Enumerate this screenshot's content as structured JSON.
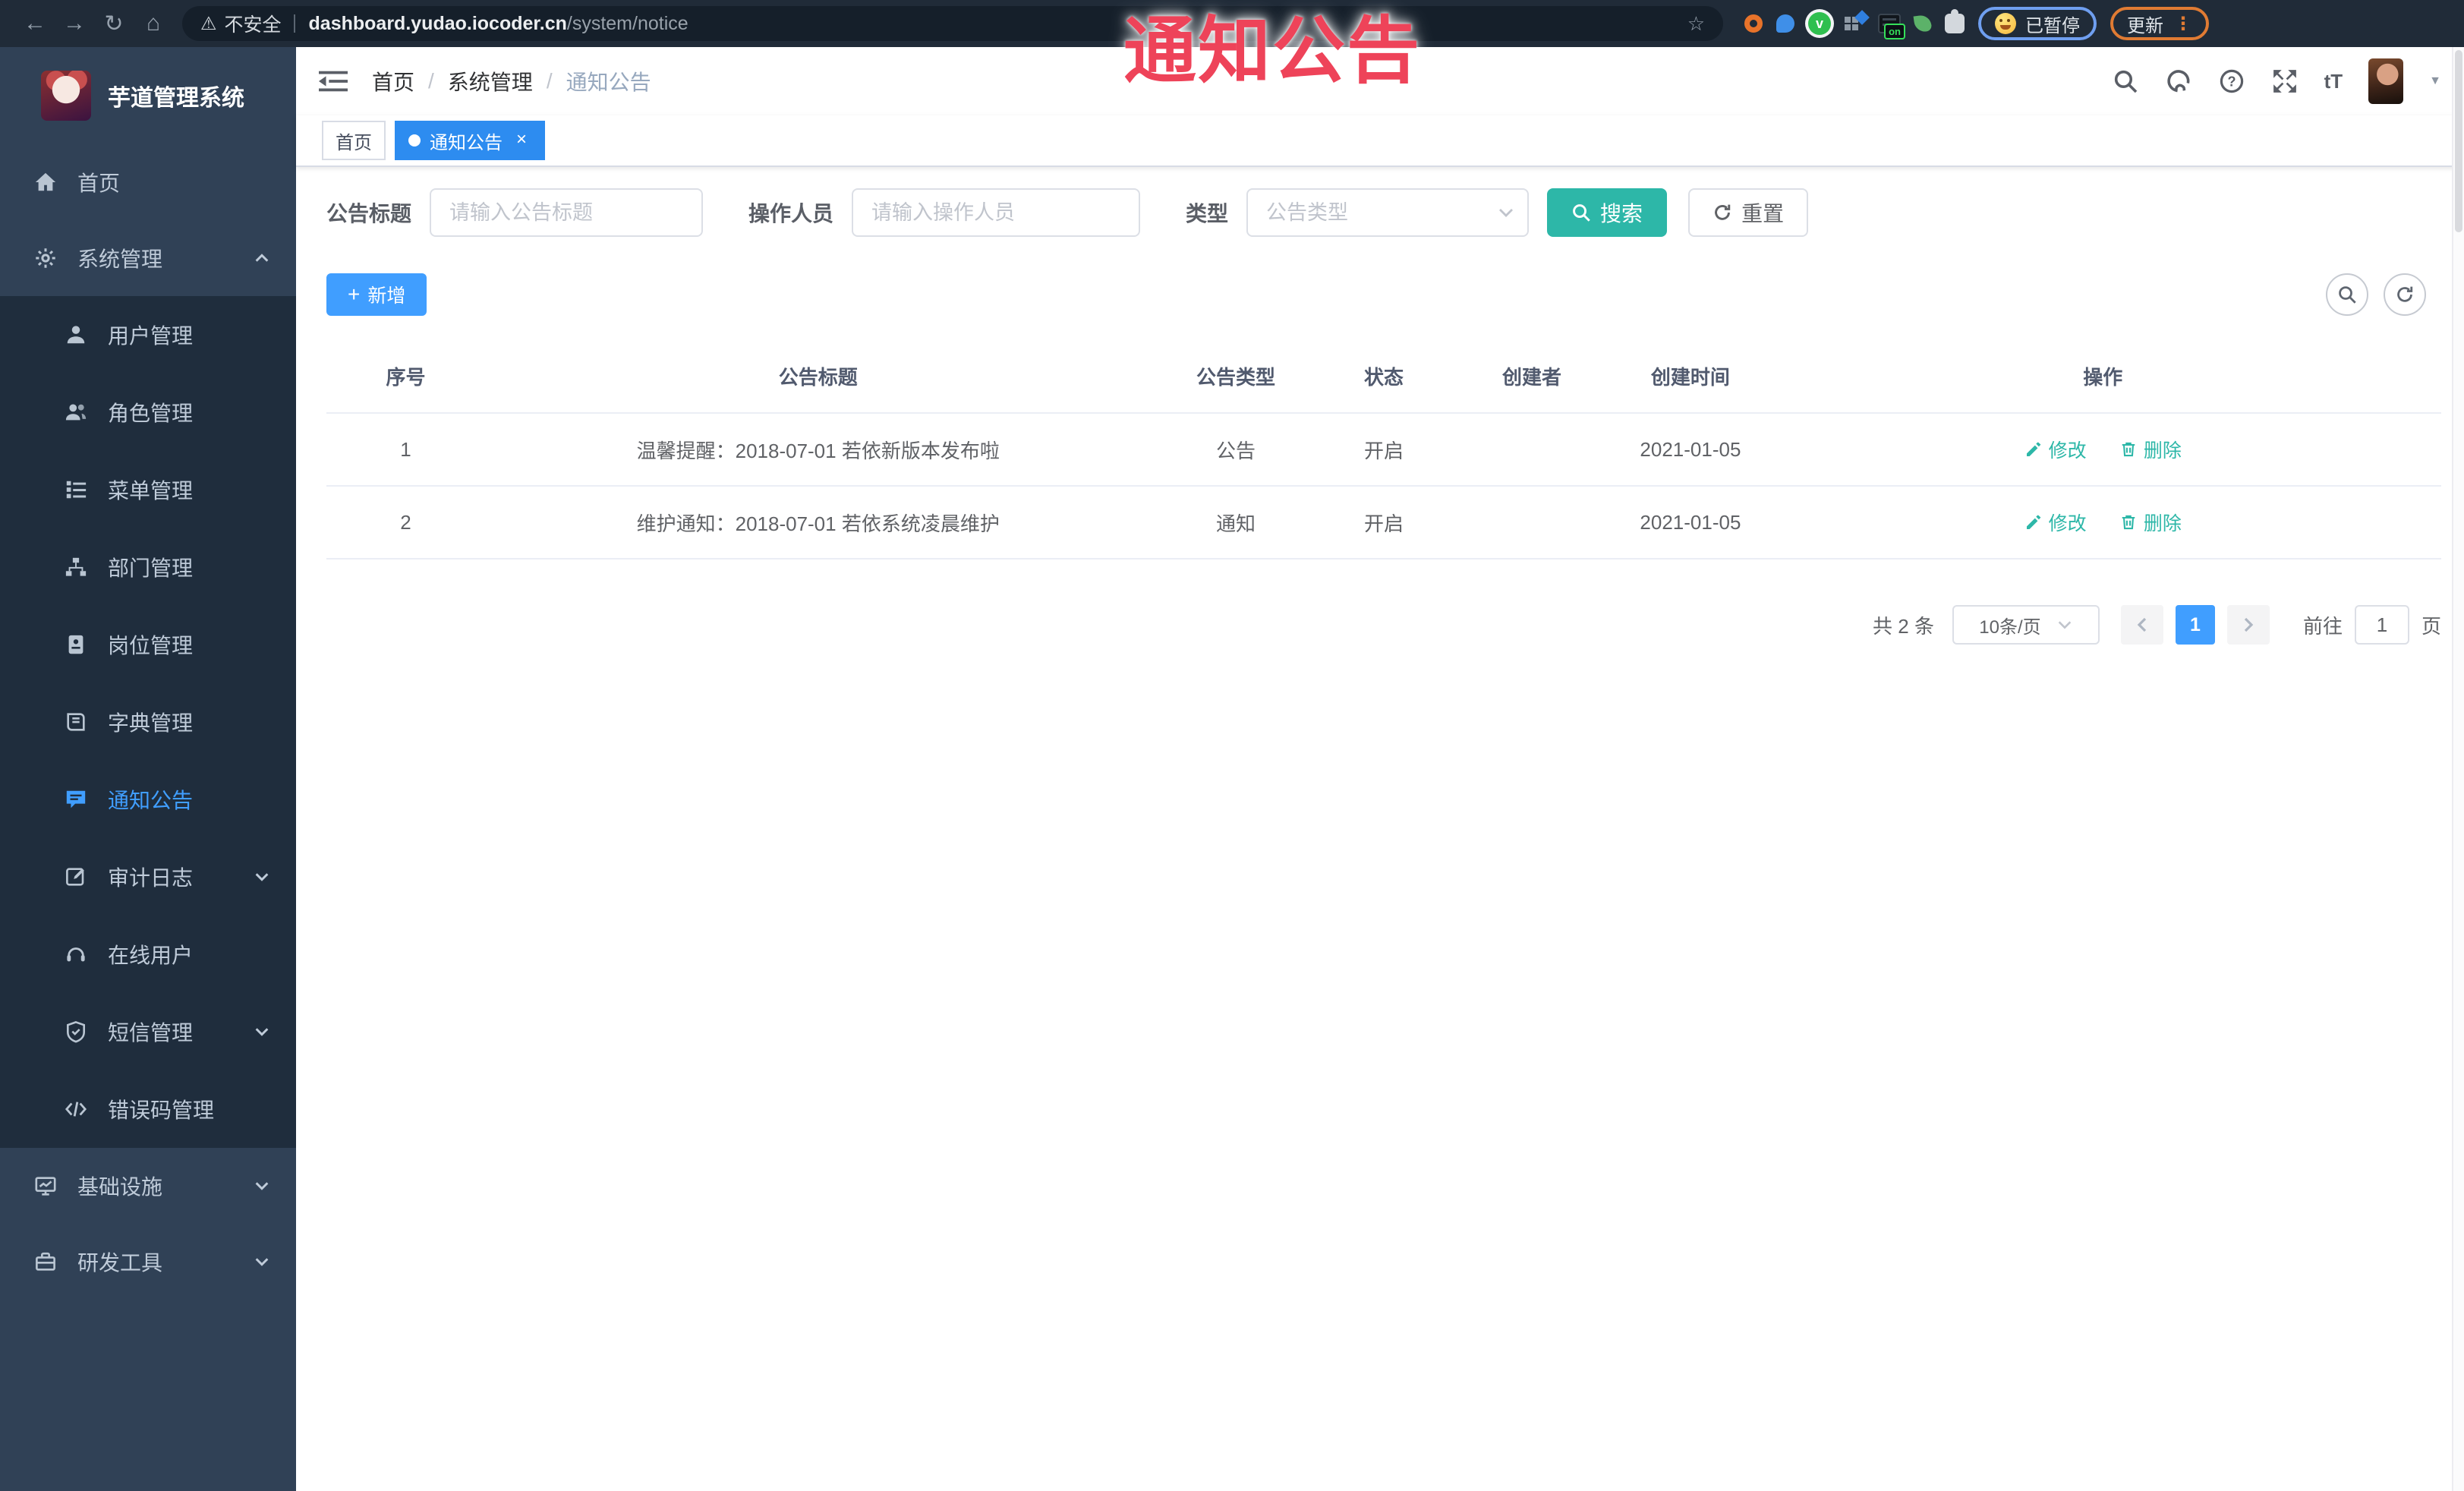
{
  "colors": {
    "primary": "#409eff",
    "tab_active_blue": "#2d8cf0",
    "teal_accent": "#2db7a8",
    "annotation_red": "#ee4359",
    "sidebar_bg": "#304156",
    "submenu_bg": "#1f2d3d"
  },
  "annotation": {
    "text": "通知公告"
  },
  "browser": {
    "security_label": "不安全",
    "url_host": "dashboard.yudao.iocoder.cn",
    "url_path": "/system/notice",
    "ext_badge": "on",
    "paused_label": "已暂停",
    "update_label": "更新",
    "menu_dots": "⋮"
  },
  "sidebar": {
    "app_title": "芋道管理系统",
    "items": [
      {
        "label": "首页"
      },
      {
        "label": "系统管理"
      },
      {
        "label": "用户管理"
      },
      {
        "label": "角色管理"
      },
      {
        "label": "菜单管理"
      },
      {
        "label": "部门管理"
      },
      {
        "label": "岗位管理"
      },
      {
        "label": "字典管理"
      },
      {
        "label": "通知公告"
      },
      {
        "label": "审计日志"
      },
      {
        "label": "在线用户"
      },
      {
        "label": "短信管理"
      },
      {
        "label": "错误码管理"
      },
      {
        "label": "基础设施"
      },
      {
        "label": "研发工具"
      }
    ]
  },
  "header": {
    "breadcrumb": [
      {
        "label": "首页"
      },
      {
        "label": "系统管理"
      },
      {
        "label": "通知公告"
      }
    ],
    "separator": "/"
  },
  "tabs": [
    {
      "label": "首页"
    },
    {
      "label": "通知公告",
      "close": "×"
    }
  ],
  "filters": {
    "title_label": "公告标题",
    "title_placeholder": "请输入公告标题",
    "operator_label": "操作人员",
    "operator_placeholder": "请输入操作人员",
    "type_label": "类型",
    "type_placeholder": "公告类型",
    "search_label": "搜索",
    "reset_label": "重置"
  },
  "toolbar": {
    "add_label": "新增"
  },
  "table": {
    "columns": [
      {
        "label": "序号"
      },
      {
        "label": "公告标题"
      },
      {
        "label": "公告类型"
      },
      {
        "label": "状态"
      },
      {
        "label": "创建者"
      },
      {
        "label": "创建时间"
      },
      {
        "label": "操作"
      }
    ],
    "rows": [
      {
        "no": "1",
        "title": "温馨提醒：2018-07-01 若依新版本发布啦",
        "type": "公告",
        "status": "开启",
        "creator": "",
        "created": "2021-01-05",
        "edit": "修改",
        "delete": "删除"
      },
      {
        "no": "2",
        "title": "维护通知：2018-07-01 若依系统凌晨维护",
        "type": "通知",
        "status": "开启",
        "creator": "",
        "created": "2021-01-05",
        "edit": "修改",
        "delete": "删除"
      }
    ]
  },
  "pagination": {
    "total": "共 2 条",
    "page_size": "10条/页",
    "current": "1",
    "goto_prefix": "前往",
    "goto_value": "1",
    "goto_suffix": "页"
  }
}
